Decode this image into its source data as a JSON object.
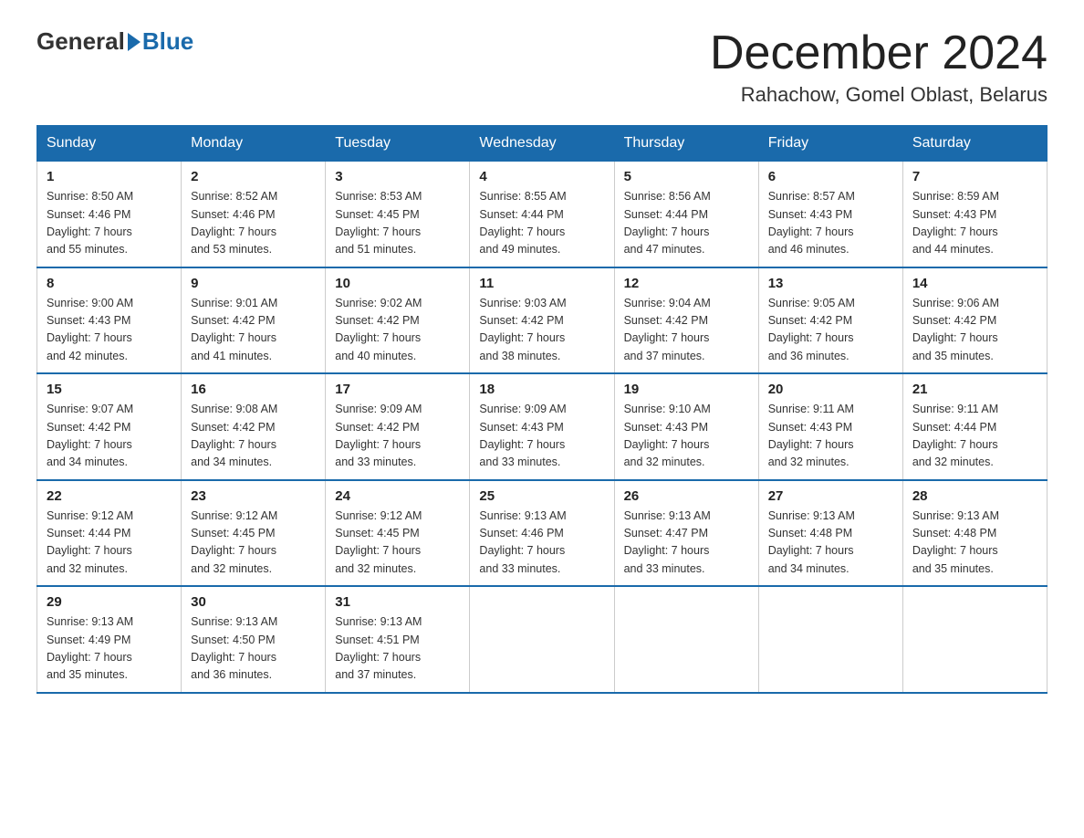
{
  "header": {
    "logo_general": "General",
    "logo_blue": "Blue",
    "month_title": "December 2024",
    "location": "Rahachow, Gomel Oblast, Belarus"
  },
  "calendar": {
    "days_of_week": [
      "Sunday",
      "Monday",
      "Tuesday",
      "Wednesday",
      "Thursday",
      "Friday",
      "Saturday"
    ],
    "weeks": [
      [
        {
          "day": "1",
          "info": "Sunrise: 8:50 AM\nSunset: 4:46 PM\nDaylight: 7 hours\nand 55 minutes."
        },
        {
          "day": "2",
          "info": "Sunrise: 8:52 AM\nSunset: 4:46 PM\nDaylight: 7 hours\nand 53 minutes."
        },
        {
          "day": "3",
          "info": "Sunrise: 8:53 AM\nSunset: 4:45 PM\nDaylight: 7 hours\nand 51 minutes."
        },
        {
          "day": "4",
          "info": "Sunrise: 8:55 AM\nSunset: 4:44 PM\nDaylight: 7 hours\nand 49 minutes."
        },
        {
          "day": "5",
          "info": "Sunrise: 8:56 AM\nSunset: 4:44 PM\nDaylight: 7 hours\nand 47 minutes."
        },
        {
          "day": "6",
          "info": "Sunrise: 8:57 AM\nSunset: 4:43 PM\nDaylight: 7 hours\nand 46 minutes."
        },
        {
          "day": "7",
          "info": "Sunrise: 8:59 AM\nSunset: 4:43 PM\nDaylight: 7 hours\nand 44 minutes."
        }
      ],
      [
        {
          "day": "8",
          "info": "Sunrise: 9:00 AM\nSunset: 4:43 PM\nDaylight: 7 hours\nand 42 minutes."
        },
        {
          "day": "9",
          "info": "Sunrise: 9:01 AM\nSunset: 4:42 PM\nDaylight: 7 hours\nand 41 minutes."
        },
        {
          "day": "10",
          "info": "Sunrise: 9:02 AM\nSunset: 4:42 PM\nDaylight: 7 hours\nand 40 minutes."
        },
        {
          "day": "11",
          "info": "Sunrise: 9:03 AM\nSunset: 4:42 PM\nDaylight: 7 hours\nand 38 minutes."
        },
        {
          "day": "12",
          "info": "Sunrise: 9:04 AM\nSunset: 4:42 PM\nDaylight: 7 hours\nand 37 minutes."
        },
        {
          "day": "13",
          "info": "Sunrise: 9:05 AM\nSunset: 4:42 PM\nDaylight: 7 hours\nand 36 minutes."
        },
        {
          "day": "14",
          "info": "Sunrise: 9:06 AM\nSunset: 4:42 PM\nDaylight: 7 hours\nand 35 minutes."
        }
      ],
      [
        {
          "day": "15",
          "info": "Sunrise: 9:07 AM\nSunset: 4:42 PM\nDaylight: 7 hours\nand 34 minutes."
        },
        {
          "day": "16",
          "info": "Sunrise: 9:08 AM\nSunset: 4:42 PM\nDaylight: 7 hours\nand 34 minutes."
        },
        {
          "day": "17",
          "info": "Sunrise: 9:09 AM\nSunset: 4:42 PM\nDaylight: 7 hours\nand 33 minutes."
        },
        {
          "day": "18",
          "info": "Sunrise: 9:09 AM\nSunset: 4:43 PM\nDaylight: 7 hours\nand 33 minutes."
        },
        {
          "day": "19",
          "info": "Sunrise: 9:10 AM\nSunset: 4:43 PM\nDaylight: 7 hours\nand 32 minutes."
        },
        {
          "day": "20",
          "info": "Sunrise: 9:11 AM\nSunset: 4:43 PM\nDaylight: 7 hours\nand 32 minutes."
        },
        {
          "day": "21",
          "info": "Sunrise: 9:11 AM\nSunset: 4:44 PM\nDaylight: 7 hours\nand 32 minutes."
        }
      ],
      [
        {
          "day": "22",
          "info": "Sunrise: 9:12 AM\nSunset: 4:44 PM\nDaylight: 7 hours\nand 32 minutes."
        },
        {
          "day": "23",
          "info": "Sunrise: 9:12 AM\nSunset: 4:45 PM\nDaylight: 7 hours\nand 32 minutes."
        },
        {
          "day": "24",
          "info": "Sunrise: 9:12 AM\nSunset: 4:45 PM\nDaylight: 7 hours\nand 32 minutes."
        },
        {
          "day": "25",
          "info": "Sunrise: 9:13 AM\nSunset: 4:46 PM\nDaylight: 7 hours\nand 33 minutes."
        },
        {
          "day": "26",
          "info": "Sunrise: 9:13 AM\nSunset: 4:47 PM\nDaylight: 7 hours\nand 33 minutes."
        },
        {
          "day": "27",
          "info": "Sunrise: 9:13 AM\nSunset: 4:48 PM\nDaylight: 7 hours\nand 34 minutes."
        },
        {
          "day": "28",
          "info": "Sunrise: 9:13 AM\nSunset: 4:48 PM\nDaylight: 7 hours\nand 35 minutes."
        }
      ],
      [
        {
          "day": "29",
          "info": "Sunrise: 9:13 AM\nSunset: 4:49 PM\nDaylight: 7 hours\nand 35 minutes."
        },
        {
          "day": "30",
          "info": "Sunrise: 9:13 AM\nSunset: 4:50 PM\nDaylight: 7 hours\nand 36 minutes."
        },
        {
          "day": "31",
          "info": "Sunrise: 9:13 AM\nSunset: 4:51 PM\nDaylight: 7 hours\nand 37 minutes."
        },
        {
          "day": "",
          "info": ""
        },
        {
          "day": "",
          "info": ""
        },
        {
          "day": "",
          "info": ""
        },
        {
          "day": "",
          "info": ""
        }
      ]
    ]
  }
}
